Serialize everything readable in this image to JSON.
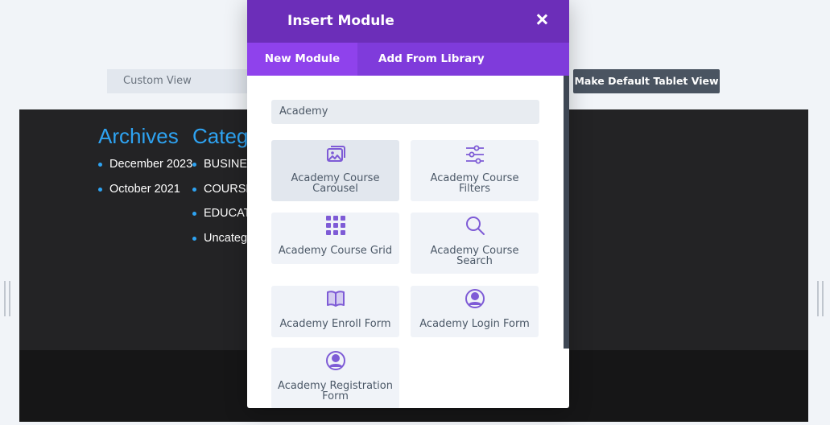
{
  "builder": {
    "custom_view": "Custom View",
    "make_default": "Make Default Tablet View"
  },
  "widgets": {
    "archives_title": "Archives",
    "archives": [
      "December 2023",
      "October 2021"
    ],
    "categories_title": "Categ",
    "categories": [
      "BUSINES",
      "COURSE",
      "EDUCAT",
      "Uncateg"
    ]
  },
  "modal": {
    "title": "Insert Module",
    "tabs": [
      "New Module",
      "Add From Library"
    ],
    "search_value": "Academy",
    "accent_color": "#6c2eb9",
    "icon_color": "#7e5bd6",
    "modules": [
      {
        "label": "Academy Course Carousel",
        "icon": "image-icon"
      },
      {
        "label": "Academy Course Filters",
        "icon": "sliders-icon"
      },
      {
        "label": "Academy Course Grid",
        "icon": "grid-icon"
      },
      {
        "label": "Academy Course Search",
        "icon": "search-icon"
      },
      {
        "label": "Academy Enroll Form",
        "icon": "book-icon"
      },
      {
        "label": "Academy Login Form",
        "icon": "user-icon"
      },
      {
        "label": "Academy Registration Form",
        "icon": "user-icon"
      }
    ]
  }
}
